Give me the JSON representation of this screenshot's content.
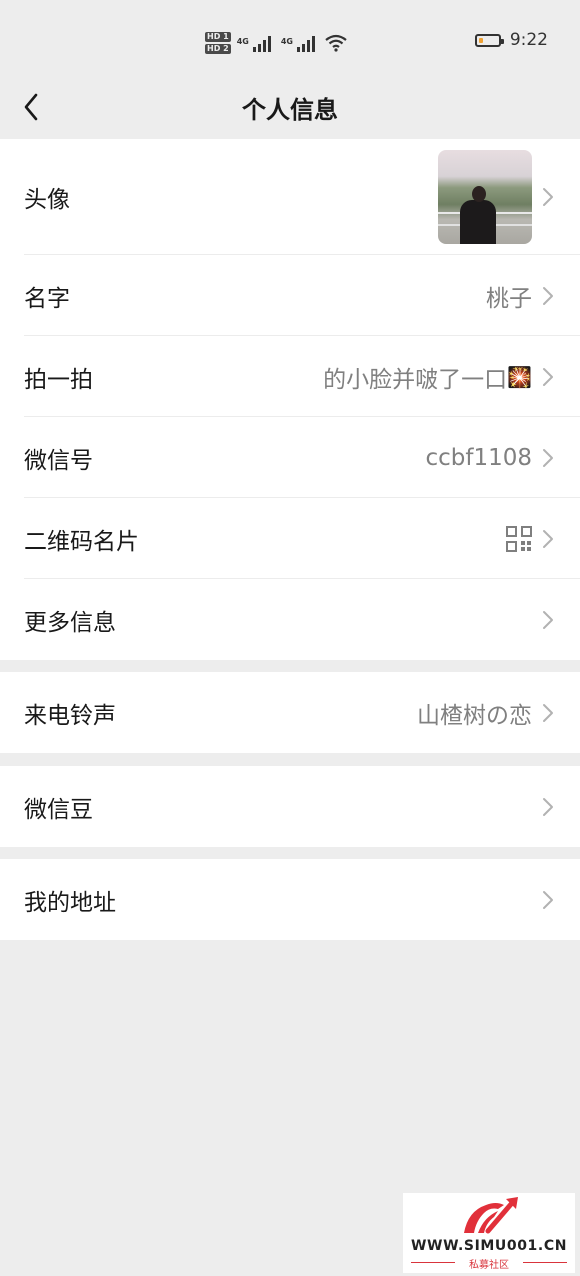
{
  "status_bar": {
    "hd_labels": [
      "HD 1",
      "HD 2"
    ],
    "network_labels": [
      "4G",
      "4G"
    ],
    "battery_level": 0.2,
    "battery_color": "#f0a132",
    "time": "9:22"
  },
  "header": {
    "back_icon": "chevron-left-icon",
    "title": "个人信息"
  },
  "groups": [
    {
      "rows": [
        {
          "label": "头像",
          "value": "",
          "type": "avatar"
        },
        {
          "label": "名字",
          "value": "桃子"
        },
        {
          "label": "拍一拍",
          "value": "的小脸并啵了一口",
          "emoji": "🎇"
        },
        {
          "label": "微信号",
          "value": "ccbf1108"
        },
        {
          "label": "二维码名片",
          "value": "",
          "type": "qr",
          "icon": "qr-code-icon"
        },
        {
          "label": "更多信息",
          "value": ""
        }
      ]
    },
    {
      "rows": [
        {
          "label": "来电铃声",
          "value": "山楂树の恋"
        }
      ]
    },
    {
      "rows": [
        {
          "label": "微信豆",
          "value": ""
        }
      ]
    },
    {
      "rows": [
        {
          "label": "我的地址",
          "value": ""
        }
      ]
    }
  ],
  "watermark": {
    "text": "WWW.SIMU001.CN",
    "subtext": "私募社区",
    "logo_color": "#e1303a"
  }
}
